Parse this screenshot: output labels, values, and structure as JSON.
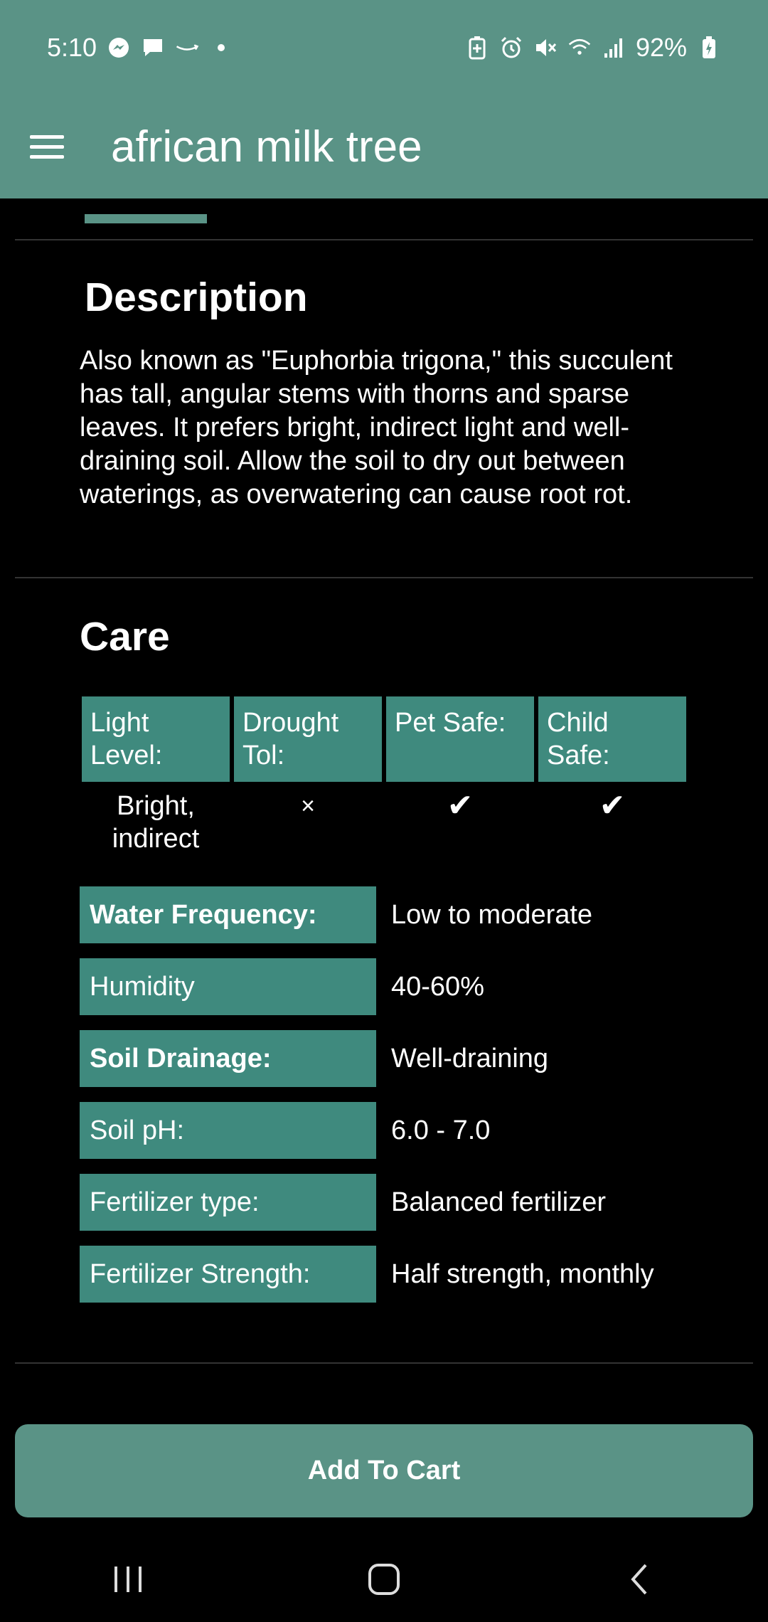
{
  "status_bar": {
    "time": "5:10",
    "battery": "92%",
    "left_icons": [
      "messenger-icon",
      "chat-icon",
      "amazon-icon",
      "dot-icon"
    ],
    "right_icons": [
      "battery-saver-icon",
      "alarm-icon",
      "mute-icon",
      "wifi-icon",
      "signal-icon",
      "battery-charging-icon"
    ]
  },
  "app_bar": {
    "title": "african milk tree",
    "menu_icon": "hamburger-menu-icon"
  },
  "description": {
    "title": "Description",
    "text": "Also known as \"Euphorbia trigona,\" this succulent has tall, angular stems with thorns and sparse leaves. It prefers bright, indirect light and well-draining soil. Allow the soil to dry out between waterings, as overwatering can cause root rot."
  },
  "care": {
    "title": "Care",
    "attributes": [
      {
        "label": "Light Level:",
        "value": "Bright, indirect"
      },
      {
        "label": "Drought Tol:",
        "value": "×"
      },
      {
        "label": "Pet Safe:",
        "value": "✔"
      },
      {
        "label": "Child Safe:",
        "value": "✔"
      }
    ],
    "rows": [
      {
        "label": "Water Frequency:",
        "value": "Low to moderate"
      },
      {
        "label": "Humidity",
        "value": "40-60%"
      },
      {
        "label": "Soil Drainage:",
        "value": "Well-draining"
      },
      {
        "label": "Soil pH:",
        "value": "6.0 - 7.0"
      },
      {
        "label": "Fertilizer type:",
        "value": "Balanced fertilizer"
      },
      {
        "label": "Fertilizer Strength:",
        "value": "Half strength, monthly"
      }
    ]
  },
  "cart_button": {
    "label": "Add To Cart"
  },
  "nav_bar": {
    "buttons": [
      "recent-apps-icon",
      "home-icon",
      "back-icon"
    ]
  },
  "colors": {
    "accent": "#5a9386",
    "cell": "#3f8a7e",
    "background": "#000000"
  }
}
